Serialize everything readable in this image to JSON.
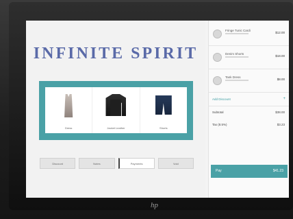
{
  "brand": {
    "title": "INFINITE SPIRIT",
    "color": "#5a6aa8"
  },
  "products": [
    {
      "label": "Dress",
      "icon": "tank-top-icon"
    },
    {
      "label": "Jacket Leather",
      "icon": "jacket-icon"
    },
    {
      "label": "Shorts",
      "icon": "shorts-icon"
    }
  ],
  "actions": [
    {
      "label": "Discount",
      "selected": false
    },
    {
      "label": "Notes",
      "selected": false
    },
    {
      "label": "Payments",
      "selected": true
    },
    {
      "label": "Void",
      "selected": false
    }
  ],
  "cart": {
    "items": [
      {
        "name": "Fringe Tunic Cardi",
        "price": "$12.00"
      },
      {
        "name": "Denim Shorts",
        "price": "$18.00"
      },
      {
        "name": "Tank Dress",
        "price": "$8.00"
      }
    ],
    "section_label": "Add Discount",
    "section_icon": "+",
    "subtotal_label": "Subtotal",
    "subtotal_value": "$38.00",
    "tax_label": "Tax (8.5%)",
    "tax_value": "$3.23"
  },
  "pay": {
    "label": "Pay",
    "total": "$41.23"
  },
  "hardware": {
    "logo": "hp"
  },
  "colors": {
    "accent": "#4aa1a6"
  }
}
